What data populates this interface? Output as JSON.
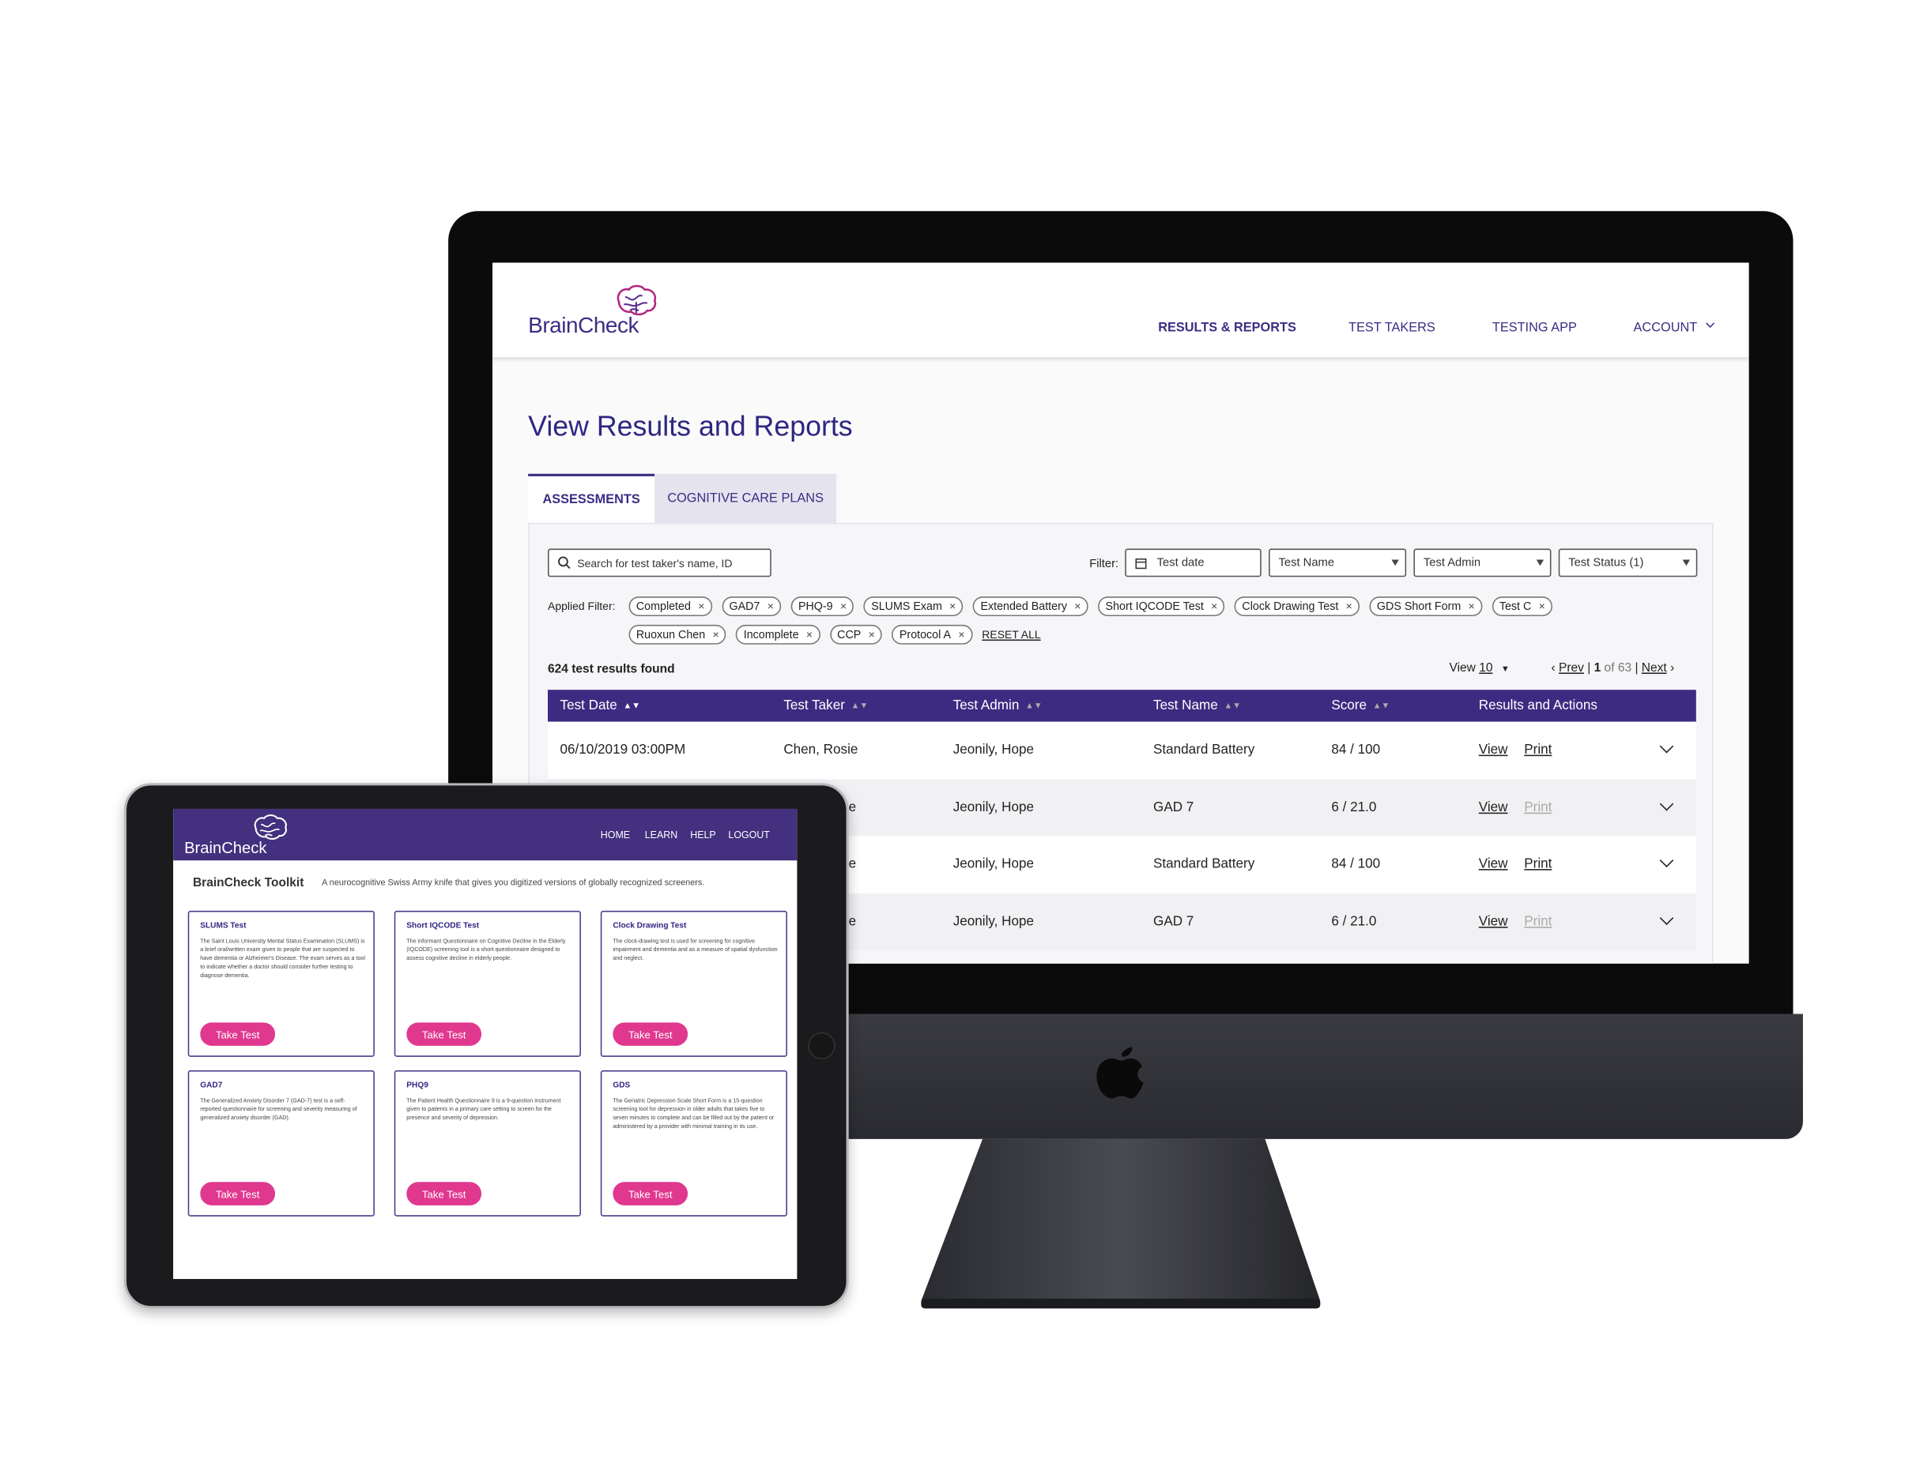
{
  "desktop": {
    "brand": "BrainCheck",
    "nav": [
      {
        "label": "RESULTS & REPORTS",
        "active": true
      },
      {
        "label": "TEST TAKERS"
      },
      {
        "label": "TESTING APP"
      },
      {
        "label": "ACCOUNT"
      }
    ],
    "page_title": "View Results and Reports",
    "tabs": [
      {
        "label": "ASSESSMENTS",
        "active": true
      },
      {
        "label": "COGNITIVE CARE PLANS"
      }
    ],
    "search_placeholder": "Search for test taker's name, ID",
    "filter_label": "Filter:",
    "filters": {
      "date": "Test date",
      "name": "Test Name",
      "admin": "Test Admin",
      "status": "Test Status (1)"
    },
    "applied_label": "Applied Filter:",
    "chips_row1": [
      "Completed",
      "GAD7",
      "PHQ-9",
      "SLUMS Exam",
      "Extended Battery",
      "Short IQCODE Test",
      "Clock Drawing Test",
      "GDS Short Form",
      "Test C"
    ],
    "chips_row2": [
      "Ruoxun Chen",
      "Incomplete",
      "CCP",
      "Protocol A"
    ],
    "chip_close": "×",
    "reset_all": "RESET ALL",
    "results_count": "624 test results found",
    "view_label": "View",
    "view_value": "10",
    "pager": {
      "prev": "Prev",
      "current": "1",
      "of": "of 63",
      "next": "Next"
    },
    "columns": [
      "Test Date",
      "Test Taker",
      "Test Admin",
      "Test Name",
      "Score",
      "Results and Actions"
    ],
    "rows": [
      {
        "date": "06/10/2019 03:00PM",
        "taker": "Chen, Rosie",
        "admin": "Jeonily, Hope",
        "test": "Standard Battery",
        "score": "84 / 100",
        "view": "View",
        "print": "Print",
        "print_enabled": true
      },
      {
        "date": "",
        "taker": "e",
        "admin": "Jeonily, Hope",
        "test": "GAD 7",
        "score": "6 / 21.0",
        "view": "View",
        "print": "Print",
        "print_enabled": false
      },
      {
        "date": "",
        "taker": "e",
        "admin": "Jeonily, Hope",
        "test": "Standard Battery",
        "score": "84 / 100",
        "view": "View",
        "print": "Print",
        "print_enabled": true
      },
      {
        "date": "",
        "taker": "e",
        "admin": "Jeonily, Hope",
        "test": "GAD 7",
        "score": "6 / 21.0",
        "view": "View",
        "print": "Print",
        "print_enabled": false
      }
    ]
  },
  "tablet": {
    "brand": "BrainCheck",
    "nav": [
      "HOME",
      "LEARN",
      "HELP",
      "LOGOUT"
    ],
    "toolkit_title": "BrainCheck Toolkit",
    "toolkit_subtitle": "A neurocognitive Swiss Army knife that gives you digitized versions of globally recognized screeners.",
    "take_label": "Take Test",
    "cards": [
      {
        "title": "SLUMS Test",
        "desc": "The Saint Louis University Mental Status Examination (SLUMS) is a brief oral/written exam given to people that are suspected to have dementia or Alzheimer's Disease. The exam serves as a tool to indicate whether a doctor should consider further testing to diagnose dementia."
      },
      {
        "title": "Short IQCODE Test",
        "desc": "The informant Questionnaire on Cognitive Decline in the Elderly (IQCODE) screening tool is a short questionnaire designed to assess cognitive decline in elderly people."
      },
      {
        "title": "Clock Drawing Test",
        "desc": "The clock-drawing test is used for screening for cognitive impairment and dementia and as a measure of spatial dysfunction and neglect."
      },
      {
        "title": "GAD7",
        "desc": "The Generalized Anxiety Disorder 7 (GAD-7) test is a self-reported questionnaire for screening and severity measuring of generalized anxiety disorder (GAD)."
      },
      {
        "title": "PHQ9",
        "desc": "The Patient Health Questionnaire 9 is a 9-question instrument given to patients in a primary care setting to screen for the presence and severity of depression."
      },
      {
        "title": "GDS",
        "desc": "The Geriatric Depression Scale Short Form is a 15-question screening tool for depression in older adults that takes five to seven minutes to complete and can be filled out by the patient or administered by a provider with minimal training in its use."
      }
    ]
  },
  "colors": {
    "brand_purple": "#3d2b82",
    "accent_pink": "#e0388f",
    "disabled": "#aaaaaa"
  }
}
